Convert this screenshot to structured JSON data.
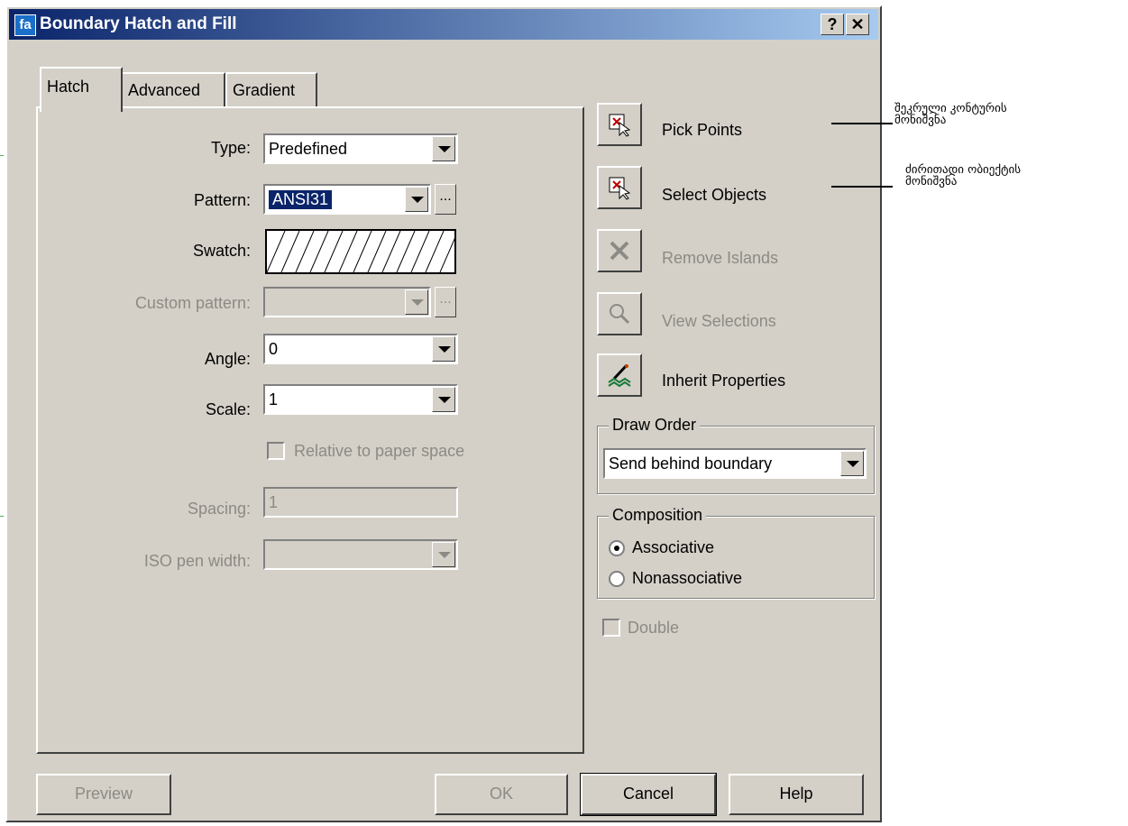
{
  "window": {
    "title": "Boundary Hatch and Fill",
    "help_glyph": "?",
    "close_glyph": "✕",
    "app_icon_glyph": "fa"
  },
  "tabs": [
    {
      "label": "Hatch"
    },
    {
      "label": "Advanced"
    },
    {
      "label": "Gradient"
    }
  ],
  "hatch": {
    "type_label": "Type:",
    "type_value": "Predefined",
    "pattern_label": "Pattern:",
    "pattern_value": "ANSI31",
    "swatch_label": "Swatch:",
    "custom_pattern_label": "Custom pattern:",
    "angle_label": "Angle:",
    "angle_value": "0",
    "scale_label": "Scale:",
    "scale_value": "1",
    "relative_label": "Relative to paper space",
    "spacing_label": "Spacing:",
    "spacing_value": "1",
    "iso_label": "ISO pen width:",
    "ellipsis": "..."
  },
  "actions": [
    {
      "label": "Pick Points",
      "icon": "pick-points-icon"
    },
    {
      "label": "Select Objects",
      "icon": "select-objects-icon"
    },
    {
      "label": "Remove Islands",
      "icon": "remove-islands-icon"
    },
    {
      "label": "View Selections",
      "icon": "view-selections-icon"
    },
    {
      "label": "Inherit Properties",
      "icon": "inherit-properties-icon"
    }
  ],
  "draw_order": {
    "title": "Draw Order",
    "value": "Send behind boundary"
  },
  "composition": {
    "title": "Composition",
    "associative": "Associative",
    "nonassociative": "Nonassociative",
    "selected": "Associative"
  },
  "double_label": "Double",
  "buttons": {
    "preview": "Preview",
    "ok": "OK",
    "cancel": "Cancel",
    "help": "Help"
  },
  "annotations": {
    "pick_points_line1": "შეკრული კონტურის",
    "pick_points_line2": "მონიშვნა",
    "select_objects_line1": "ძირითადი ობიექტის",
    "select_objects_line2": "მონიშვნა"
  },
  "colors": {
    "face": "#d4d0c8",
    "title_start": "#0a246a",
    "title_end": "#a6caf0",
    "selection": "#0a246a",
    "disabled_text": "#8c8a84"
  }
}
